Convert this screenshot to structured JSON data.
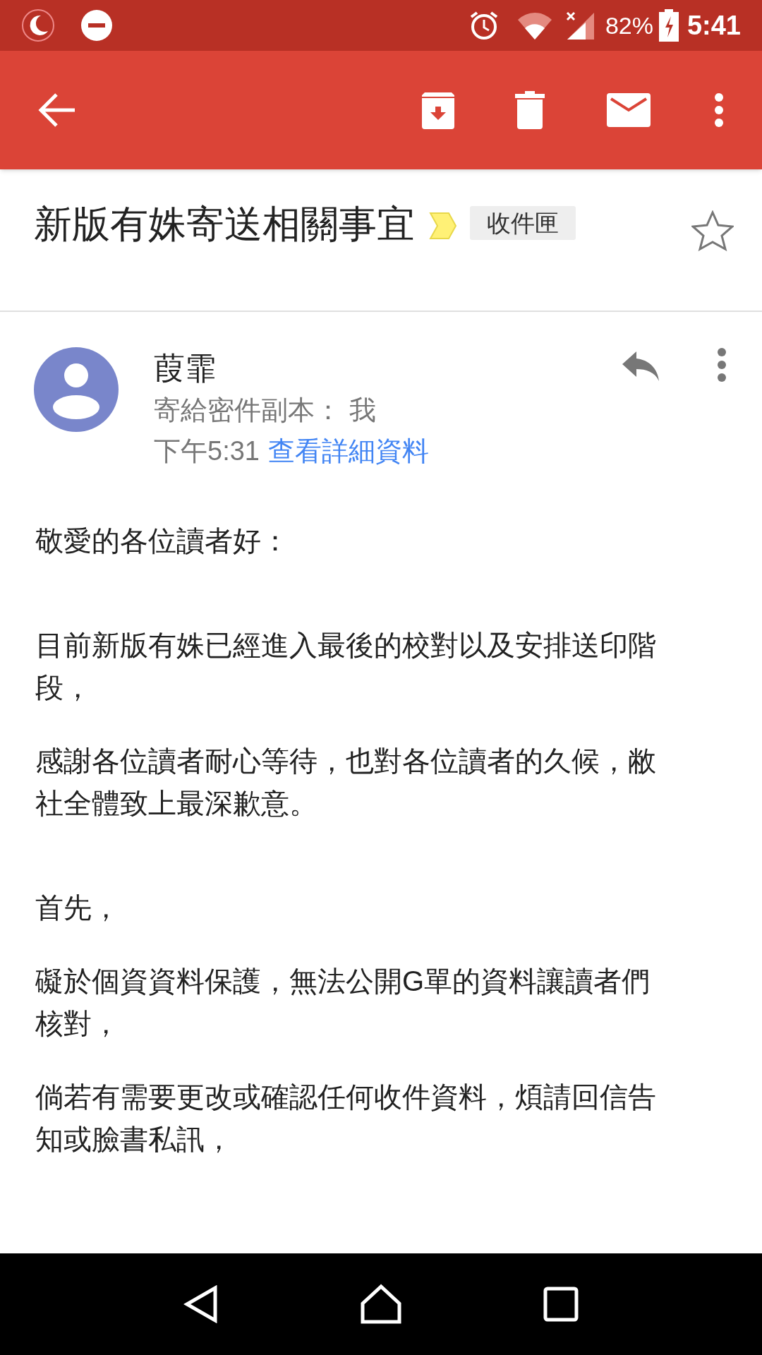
{
  "status_bar": {
    "battery": "82%",
    "time": "5:41"
  },
  "subject": {
    "title": "新版有姝寄送相關事宜",
    "label": "收件匣",
    "starred": false
  },
  "message": {
    "sender": "葭霏",
    "recipients": "寄給密件副本： 我",
    "time": "下午5:31",
    "details_link": "查看詳細資料"
  },
  "body": {
    "sections": [
      [
        "敬愛的各位讀者好："
      ],
      [
        "目前新版有姝已經進入最後的校對以及安排送印階段，",
        "感謝各位讀者耐心等待，也對各位讀者的久候，敝社全體致上最深歉意。"
      ],
      [
        "首先，",
        "礙於個資資料保護，無法公開G單的資料讓讀者們核對，",
        "倘若有需要更改或確認任何收件資料，煩請回信告知或臉書私訊，"
      ]
    ]
  }
}
